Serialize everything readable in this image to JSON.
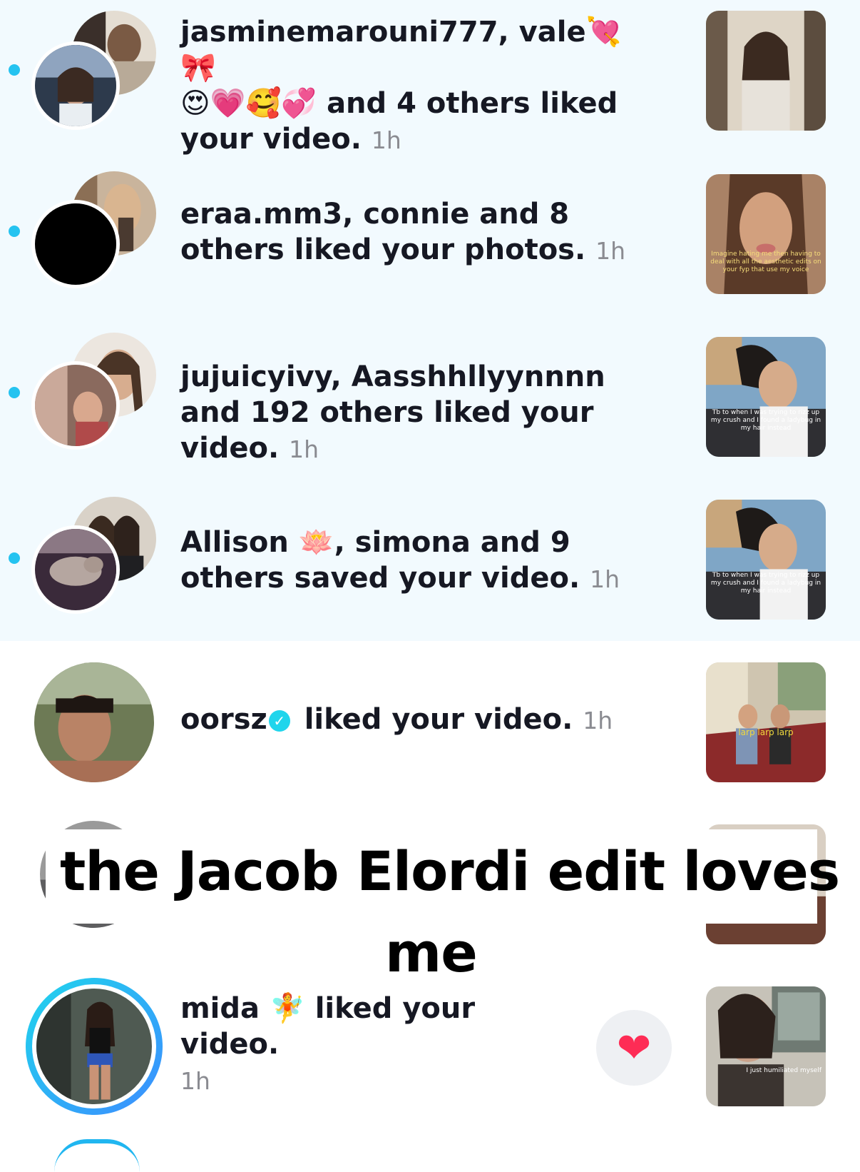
{
  "colors": {
    "unread_bg": "#f2fafe",
    "dot": "#25c3f0",
    "time": "#8a8b91",
    "heart": "#fe2c55",
    "ring": "#20d5ec"
  },
  "notifications": [
    {
      "names": "jasminemarouni777, vale",
      "name_emojis": "💘🎀",
      "line2_emojis": "😍💗🥰💞",
      "action": "and 4 others liked",
      "action2": "your video.",
      "time": "1h",
      "unread": true
    },
    {
      "text": "eraa.mm3, connie and 8 others liked your photos.",
      "time": "1h",
      "unread": true,
      "thumb_caption": "Imagine hating me then having to deal with all the aesthetic edits on your fyp that use my voice"
    },
    {
      "text": "jujuicyivy, Aasshhllyynnnn and 192 others liked your video.",
      "time": "1h",
      "unread": true,
      "thumb_caption": "Tb to when I was trying to rizz up my crush and I found a ladybug in my hair instead"
    },
    {
      "name1": "Allison",
      "name1_emoji": "🪷",
      "rest": ", simona and 9 others saved your video.",
      "time": "1h",
      "unread": true,
      "thumb_caption": "Tb to when I was trying to rizz up my crush and I found a ladybug in my hair instead"
    },
    {
      "name": "oorsz",
      "verified_icon": "✓",
      "action": "liked your video.",
      "time": "1h",
      "unread": false,
      "thumb_caption": "larp larp larp"
    },
    {
      "name": "mida",
      "name_emoji": "🧚",
      "action": "liked your video.",
      "time": "1h",
      "unread": false,
      "thumb_caption": "I just humiliated myself",
      "heart_icon": "❤"
    }
  ],
  "overlay": {
    "line1": "the Jacob Elordi edit loves",
    "line2": "me"
  }
}
